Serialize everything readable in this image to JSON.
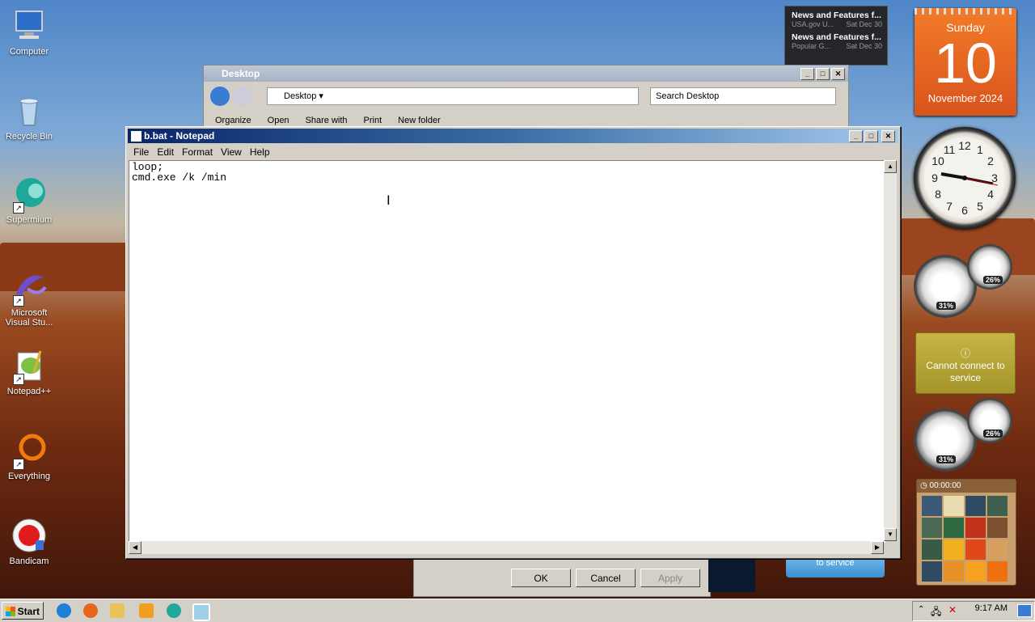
{
  "desktop": {
    "icons": [
      {
        "label": "Computer"
      },
      {
        "label": "Recycle Bin"
      },
      {
        "label": "Supermium"
      },
      {
        "label": "Microsoft Visual Stu..."
      },
      {
        "label": "Notepad++"
      },
      {
        "label": "Everything"
      },
      {
        "label": "Bandicam"
      }
    ]
  },
  "gadgets": {
    "news": [
      {
        "title": "News and Features f...",
        "source": "USA.gov U...",
        "date": "Sat Dec 30"
      },
      {
        "title": "News and Features f...",
        "source": "Popular G...",
        "date": "Sat Dec 30"
      }
    ],
    "calendar": {
      "weekday": "Sunday",
      "day": "10",
      "month_year": "November 2024"
    },
    "cpu_meter_1": {
      "cpu": "31%",
      "ram": "26%"
    },
    "cpu_meter_2": {
      "cpu": "31%",
      "ram": "26%"
    },
    "weather": {
      "message": "Cannot connect to service"
    },
    "puzzle": {
      "timer": "00:00:00"
    },
    "blue_partial": {
      "text": "to service"
    }
  },
  "explorer": {
    "title": "Desktop",
    "address": "Desktop",
    "search_placeholder": "Search Desktop",
    "commands": [
      "Organize",
      "Open",
      "Share with",
      "Print",
      "New folder"
    ]
  },
  "dialog": {
    "ok": "OK",
    "cancel": "Cancel",
    "apply": "Apply"
  },
  "notepad": {
    "title": "b.bat - Notepad",
    "menu": [
      "File",
      "Edit",
      "Format",
      "View",
      "Help"
    ],
    "content": "loop;\ncmd.exe /k /min"
  },
  "taskbar": {
    "start_label": "Start",
    "clock": "9:17 AM"
  },
  "colors": {
    "title_active": "#0a246a",
    "calendar_orange": "#f27c2a"
  }
}
